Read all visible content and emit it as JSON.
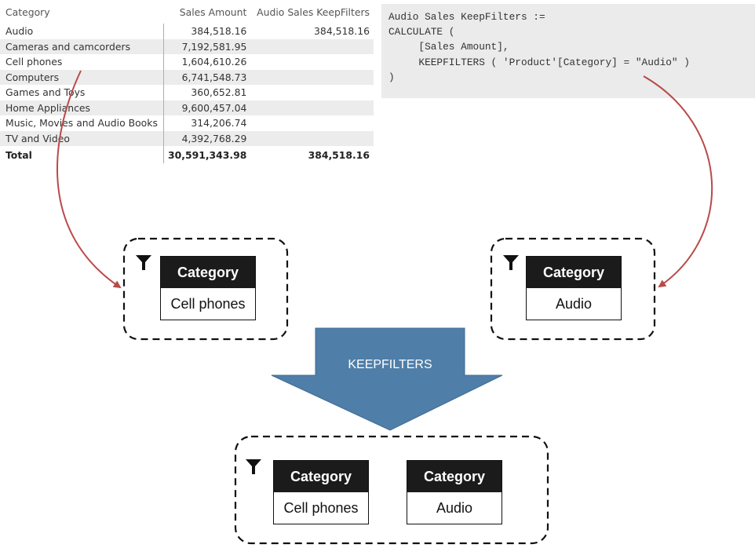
{
  "table": {
    "headers": [
      "Category",
      "Sales Amount",
      "Audio Sales KeepFilters"
    ],
    "rows": [
      [
        "Audio",
        "384,518.16",
        "384,518.16"
      ],
      [
        "Cameras and camcorders",
        "7,192,581.95",
        ""
      ],
      [
        "Cell phones",
        "1,604,610.26",
        ""
      ],
      [
        "Computers",
        "6,741,548.73",
        ""
      ],
      [
        "Games and Toys",
        "360,652.81",
        ""
      ],
      [
        "Home Appliances",
        "9,600,457.04",
        ""
      ],
      [
        "Music, Movies and Audio Books",
        "314,206.74",
        ""
      ],
      [
        "TV and Video",
        "4,392,768.29",
        ""
      ]
    ],
    "total": [
      "Total",
      "30,591,343.98",
      "384,518.16"
    ]
  },
  "code": {
    "lines": [
      "Audio Sales KeepFilters :=",
      "CALCULATE (",
      "     [Sales Amount],",
      "     KEEPFILTERS ( 'Product'[Category] = \"Audio\" )",
      ")"
    ]
  },
  "filters": {
    "left": {
      "header": "Category",
      "value": "Cell phones"
    },
    "right": {
      "header": "Category",
      "value": "Audio"
    },
    "result": [
      {
        "header": "Category",
        "value": "Cell phones"
      },
      {
        "header": "Category",
        "value": "Audio"
      }
    ]
  },
  "arrow": {
    "label": "KEEPFILTERS",
    "color": "#4f7ea8"
  },
  "colors": {
    "connector": "#b94a48",
    "grid_accent": "#7fc4b8",
    "header_fill": "#1b1b1b"
  },
  "icons": [
    "funnel-icon"
  ]
}
